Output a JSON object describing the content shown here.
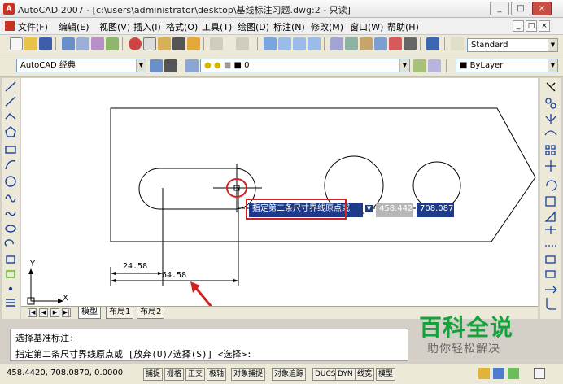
{
  "window": {
    "title": "AutoCAD 2007 - [c:\\users\\administrator\\desktop\\基线标注习题.dwg:2 - 只读]",
    "buttons": [
      "_",
      "□",
      "×"
    ]
  },
  "menubar": {
    "items": [
      "文件(F)",
      "编辑(E)",
      "视图(V)",
      "插入(I)",
      "格式(O)",
      "工具(T)",
      "绘图(D)",
      "标注(N)",
      "修改(M)",
      "窗口(W)",
      "帮助(H)"
    ],
    "doc_buttons": [
      "_",
      "□",
      "×"
    ]
  },
  "toolbar": {
    "text_style": "Standard",
    "workspace": "AutoCAD 经典",
    "layer": "0",
    "linetype": "ByLayer"
  },
  "drawing": {
    "dim_small": "24.58",
    "dim_large": "64.58",
    "ucs_y": "Y",
    "ucs_x": "X",
    "tooltip_prompt": "指定第二条尺寸界线原点或",
    "tooltip_x": "458.442",
    "tooltip_y": "708.087",
    "colors": {
      "highlight": "#d42020",
      "arrow": "#d42020",
      "tooltip_bg": "#1e3a8a"
    }
  },
  "tabs": [
    "模型",
    "布局1",
    "布局2"
  ],
  "command": {
    "line1": "选择基准标注:",
    "line2": "指定第二条尺寸界线原点或 [放弃(U)/选择(S)] <选择>:"
  },
  "status": {
    "coords": "458.4420,  708.0870,  0.0000",
    "toggles": [
      "捕捉",
      "栅格",
      "正交",
      "极轴",
      "对象捕捉",
      "对象追踪",
      "DUCS",
      "DYN",
      "线宽",
      "模型"
    ]
  },
  "watermark": {
    "title": "百科全说",
    "subtitle": "助你轻松解决"
  }
}
